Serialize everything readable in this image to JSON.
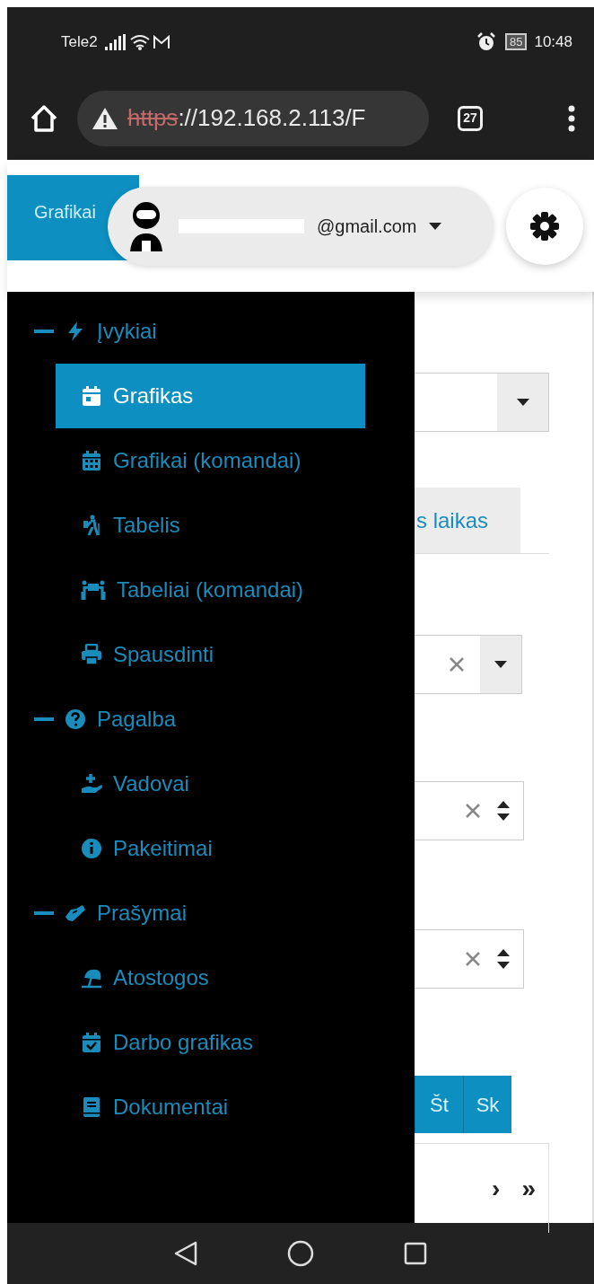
{
  "status_bar": {
    "carrier": "Tele2",
    "battery": "85",
    "time": "10:48"
  },
  "browser": {
    "url_scheme": "https",
    "url_rest": "://192.168.2.113/F",
    "tab_count": "27"
  },
  "header": {
    "tab_label": "Grafikai",
    "user_email": "@gmail.com"
  },
  "sidebar": {
    "groups": [
      {
        "label": "Įvykiai",
        "expanded": true,
        "children": [
          {
            "label": "Grafikas",
            "selected": true
          },
          {
            "label": "Grafikai (komandai)",
            "selected": false
          },
          {
            "label": "Tabelis",
            "selected": false
          },
          {
            "label": "Tabeliai (komandai)",
            "selected": false
          },
          {
            "label": "Spausdinti",
            "selected": false
          }
        ]
      },
      {
        "label": "Pagalba",
        "expanded": true,
        "children": [
          {
            "label": "Vadovai",
            "selected": false
          },
          {
            "label": "Pakeitimai",
            "selected": false
          }
        ]
      },
      {
        "label": "Prašymai",
        "expanded": true,
        "children": [
          {
            "label": "Atostogos",
            "selected": false
          },
          {
            "label": "Darbo grafikas",
            "selected": false
          },
          {
            "label": "Dokumentai",
            "selected": false
          }
        ]
      }
    ]
  },
  "content": {
    "tab_label": "s laikas",
    "weekday_buttons": [
      "Št",
      "Sk"
    ],
    "pager_buttons": [
      "›",
      "»"
    ]
  }
}
